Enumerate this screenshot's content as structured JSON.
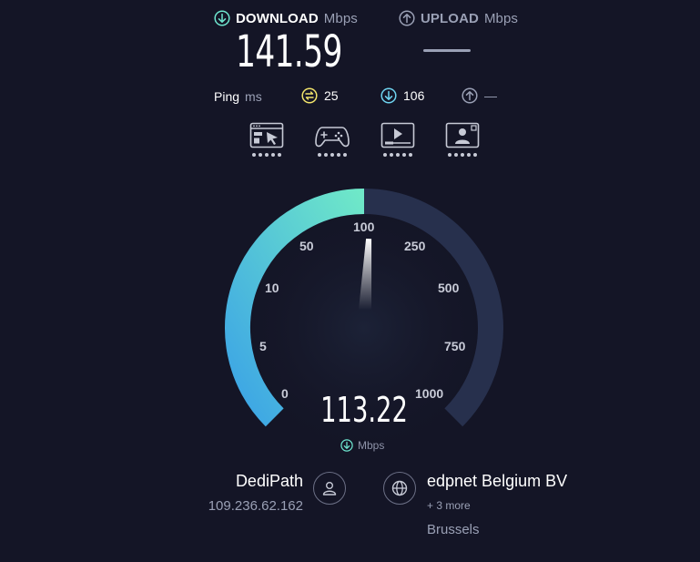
{
  "download": {
    "label": "DOWNLOAD",
    "unit": "Mbps",
    "value": "141.59",
    "icon": "download-arrow-icon",
    "accent": "#6ee6cf"
  },
  "upload": {
    "label": "UPLOAD",
    "unit": "Mbps",
    "value": "",
    "icon": "upload-arrow-icon"
  },
  "ping": {
    "label": "Ping",
    "unit": "ms",
    "idle": "25",
    "download": "106",
    "upload": "—",
    "idle_color": "#f2e46b",
    "download_color": "#6fd4f0"
  },
  "activities": [
    {
      "icon": "web-browsing-icon"
    },
    {
      "icon": "gaming-icon"
    },
    {
      "icon": "video-streaming-icon"
    },
    {
      "icon": "video-chat-icon"
    }
  ],
  "gauge": {
    "current_speed": "113.22",
    "unit": "Mbps",
    "ticks": [
      "0",
      "5",
      "10",
      "50",
      "100",
      "250",
      "500",
      "750",
      "1000"
    ],
    "fill_fraction": 0.5,
    "needle_value": 113.22,
    "gradient_start": "#3ba3e6",
    "gradient_end": "#6fe8c8",
    "track_color": "#27304d"
  },
  "provider": {
    "name": "DediPath",
    "ip": "109.236.62.162",
    "icon": "user-icon"
  },
  "server": {
    "name": "edpnet Belgium BV",
    "more": "+ 3 more",
    "location": "Brussels",
    "icon": "globe-icon"
  }
}
